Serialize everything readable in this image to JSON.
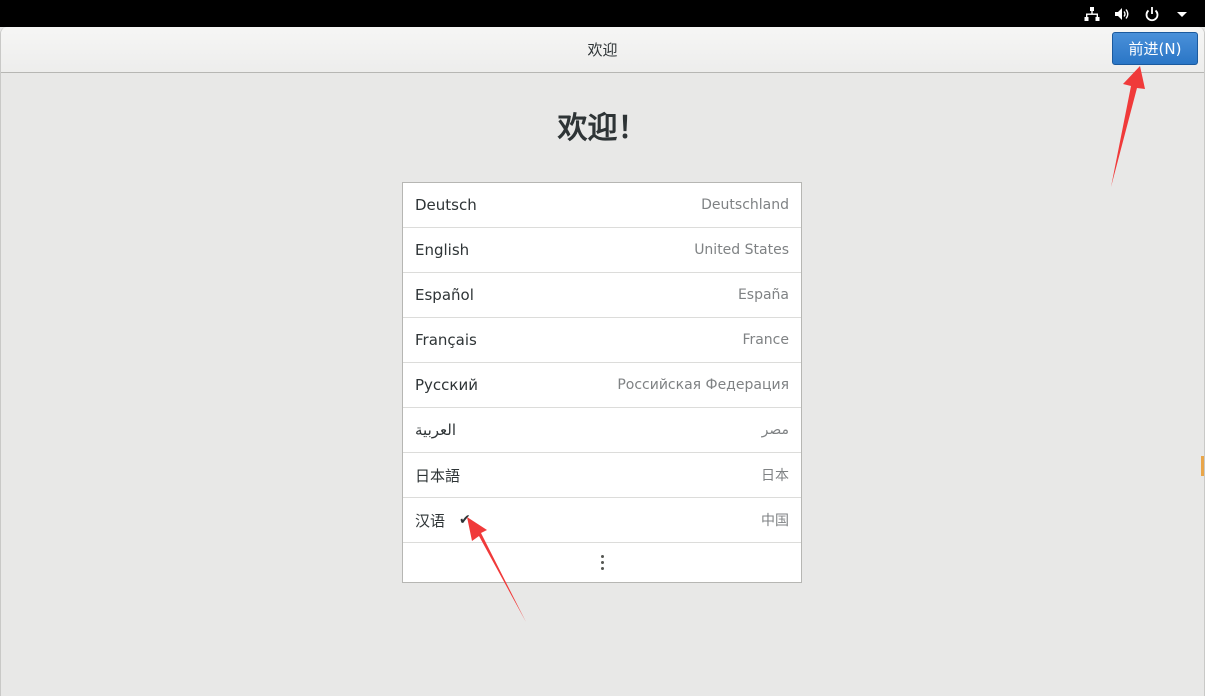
{
  "topbar": {
    "icons": [
      "network-icon",
      "volume-icon",
      "power-icon",
      "chevron-down-icon"
    ]
  },
  "header": {
    "title": "欢迎",
    "next_label": "前进(N)"
  },
  "page": {
    "title": "欢迎！"
  },
  "languages": [
    {
      "name": "Deutsch",
      "region": "Deutschland",
      "selected": false
    },
    {
      "name": "English",
      "region": "United States",
      "selected": false
    },
    {
      "name": "Español",
      "region": "España",
      "selected": false
    },
    {
      "name": "Français",
      "region": "France",
      "selected": false
    },
    {
      "name": "Русский",
      "region": "Российская Федерация",
      "selected": false
    },
    {
      "name": "العربية",
      "region": "مصر",
      "selected": false
    },
    {
      "name": "日本語",
      "region": "日本",
      "selected": false
    },
    {
      "name": "汉语",
      "region": "中国",
      "selected": true
    }
  ],
  "check_glyph": "✔",
  "annotation_color": "#f03a3a",
  "accent_color": "#3584e4"
}
